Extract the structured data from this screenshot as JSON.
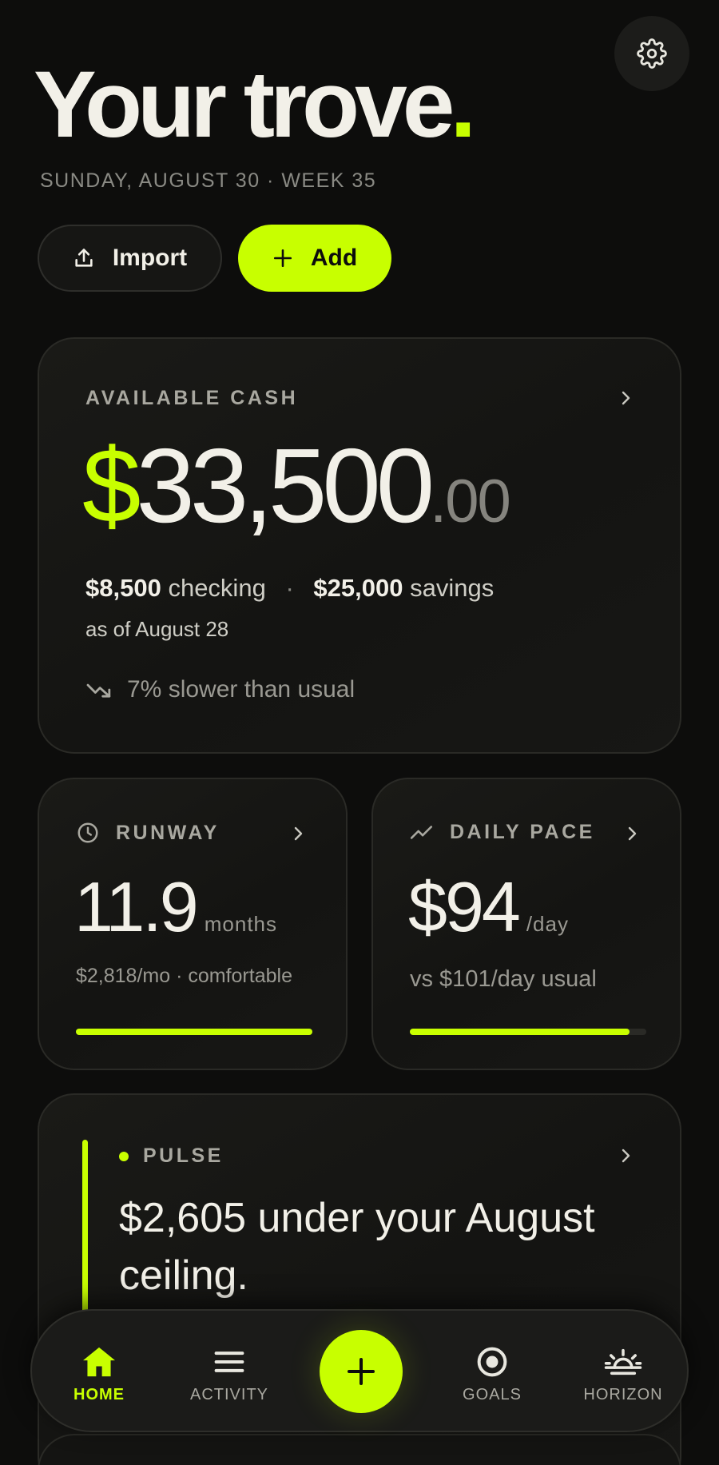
{
  "header": {
    "title": "Your trove",
    "title_dot": ".",
    "date_line": "SUNDAY, AUGUST 30 · WEEK 35",
    "settings_icon": "gear-icon"
  },
  "actions": {
    "import_label": "Import",
    "add_label": "Add"
  },
  "available_cash": {
    "label": "AVAILABLE CASH",
    "currency": "$",
    "amount": "33,500",
    "cents": ".00",
    "checking_amount": "$8,500",
    "checking_label": "checking",
    "separator": "·",
    "savings_amount": "$25,000",
    "savings_label": "savings",
    "as_of": "as of August 28",
    "trend": "7% slower than usual"
  },
  "runway": {
    "label": "RUNWAY",
    "value": "11.9",
    "unit": "months",
    "sub": "$2,818/mo · comfortable",
    "progress": 1.0
  },
  "daily_pace": {
    "label": "DAILY PACE",
    "value": "$94",
    "unit": "/day",
    "sub": "vs $101/day usual",
    "progress": 0.93
  },
  "pulse": {
    "label": "PULSE",
    "message": "$2,605 under your August ceiling."
  },
  "nav": {
    "items": [
      {
        "label": "HOME",
        "icon": "home-icon",
        "active": true
      },
      {
        "label": "ACTIVITY",
        "icon": "menu-icon",
        "active": false
      },
      {
        "label": "",
        "icon": "plus-icon",
        "active": false
      },
      {
        "label": "GOALS",
        "icon": "target-icon",
        "active": false
      },
      {
        "label": "HORIZON",
        "icon": "sunrise-icon",
        "active": false
      }
    ]
  },
  "colors": {
    "accent": "#c8ff00",
    "background": "#0d0d0c",
    "text": "#f2f0e8",
    "muted": "#9a9992"
  }
}
